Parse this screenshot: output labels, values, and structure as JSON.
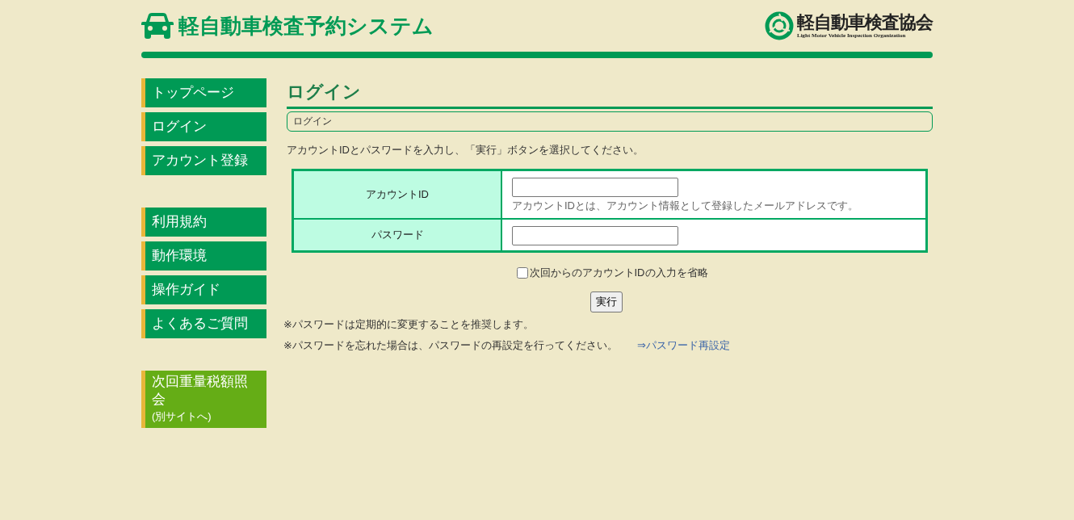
{
  "header": {
    "title": "軽自動車検査予約システム",
    "org_name": "軽自動車検査協会",
    "org_name_en": "Light Motor Vehicle Inspection Organization"
  },
  "sidebar": {
    "groups": [
      [
        {
          "label": "トップページ",
          "kind": "nav"
        },
        {
          "label": "ログイン",
          "kind": "nav"
        },
        {
          "label": "アカウント登録",
          "kind": "nav"
        }
      ],
      [
        {
          "label": "利用規約",
          "kind": "nav"
        },
        {
          "label": "動作環境",
          "kind": "nav"
        },
        {
          "label": "操作ガイド",
          "kind": "nav"
        },
        {
          "label": "よくあるご質問",
          "kind": "nav"
        }
      ],
      [
        {
          "label": "次回重量税額照会",
          "sub": "(別サイトへ)",
          "kind": "external"
        }
      ]
    ]
  },
  "page": {
    "heading": "ログイン",
    "breadcrumb": "ログイン",
    "instruction": "アカウントIDとパスワードを入力し、「実行」ボタンを選択してください。",
    "form_rows": [
      {
        "label": "アカウントID",
        "hint": "アカウントIDとは、アカウント情報として登録したメールアドレスです。"
      },
      {
        "label": "パスワード"
      }
    ],
    "remember": {
      "label": "次回からのアカウントIDの入力を省略",
      "checked": false
    },
    "submit": "実行",
    "notes": [
      {
        "text": "※パスワードは定期的に変更することを推奨します。"
      },
      {
        "text": "※パスワードを忘れた場合は、パスワードの再設定を行ってください。",
        "link": "⇒パスワード再設定"
      }
    ]
  }
}
